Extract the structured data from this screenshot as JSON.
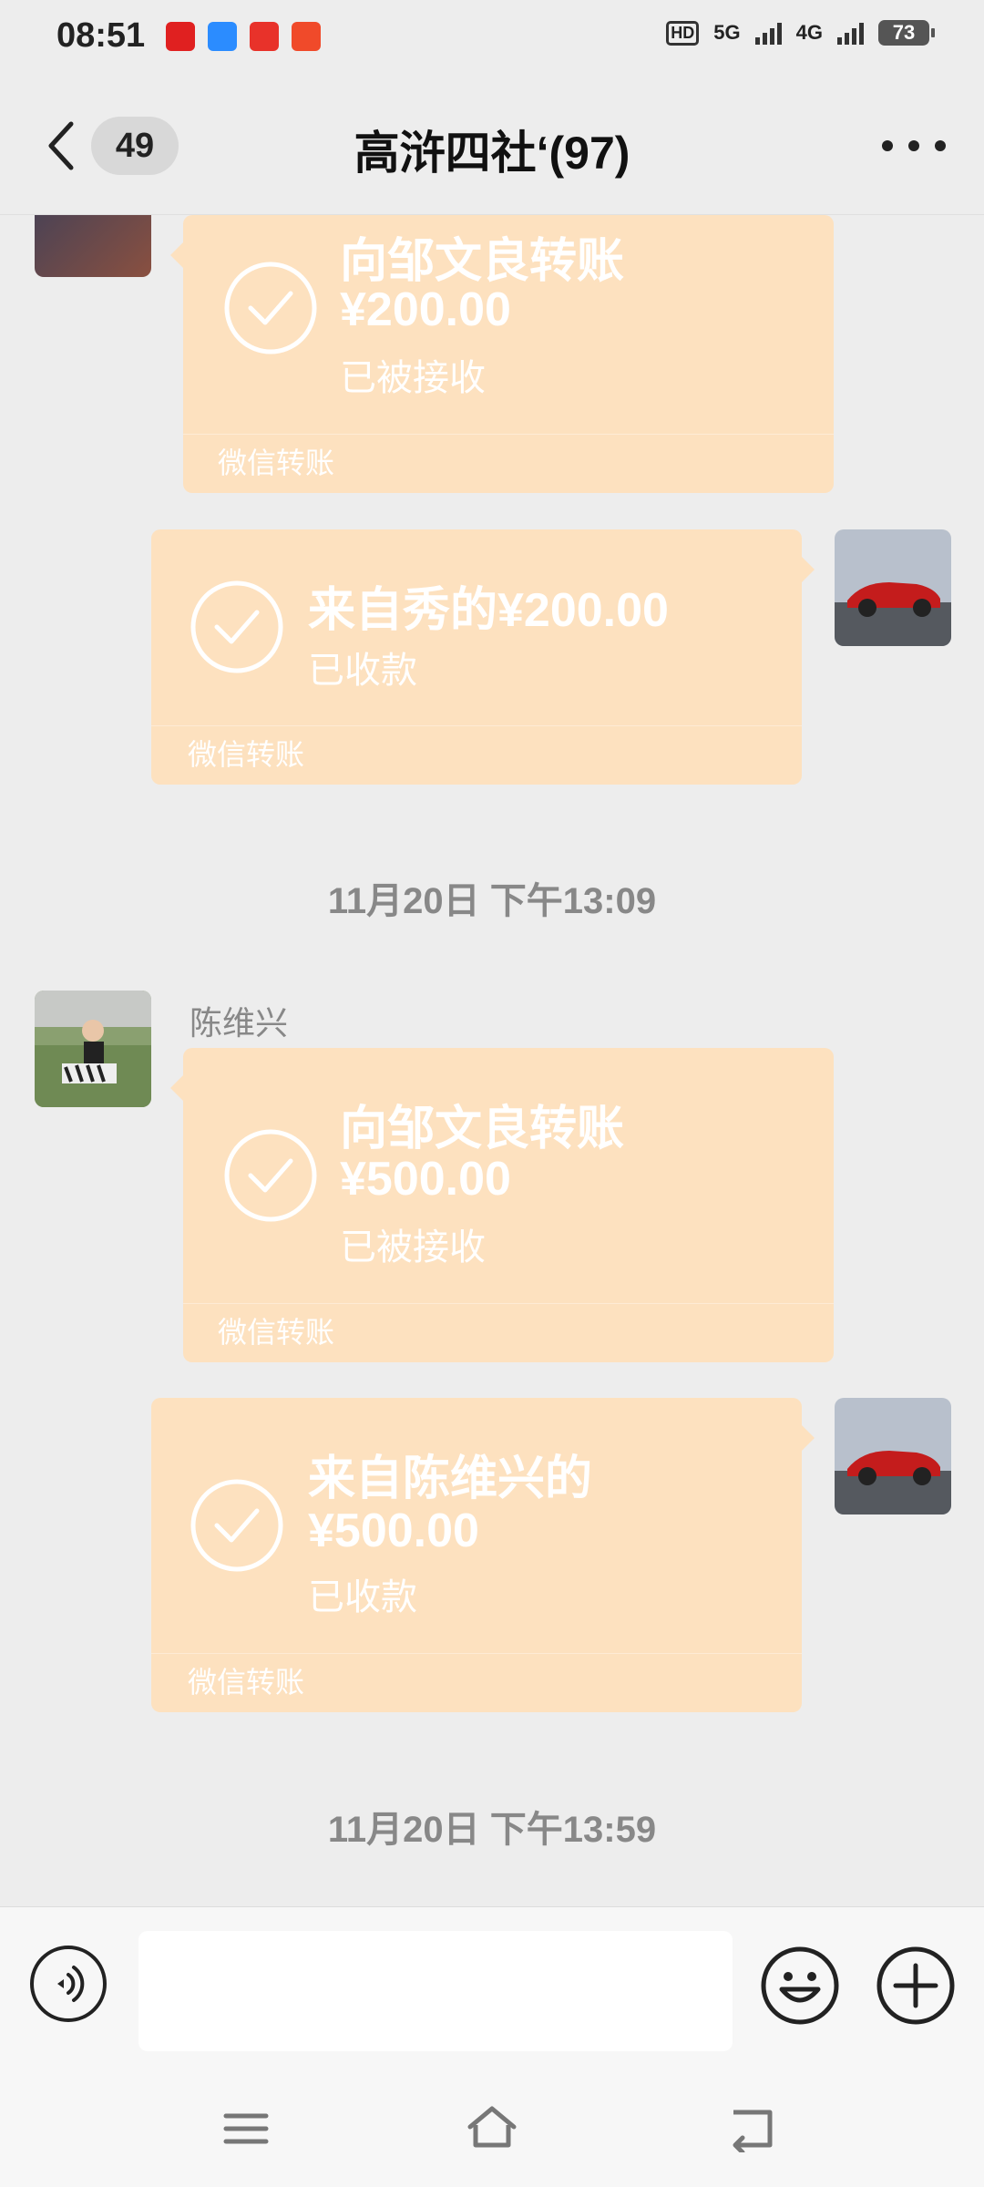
{
  "status_bar": {
    "time": "08:51",
    "network_hd": "HD",
    "network_5g": "5G",
    "network_4g": "4G",
    "battery": "73"
  },
  "header": {
    "unread_count": "49",
    "title": "高浒四社‘(97)"
  },
  "messages": [
    {
      "side": "left",
      "title": "向邹文良转账",
      "amount": "¥200.00",
      "status": "已被接收",
      "footer": "微信转账"
    },
    {
      "side": "right",
      "title": "来自秀的¥200.00",
      "status": "已收款",
      "footer": "微信转账"
    },
    {
      "timestamp": "11月20日 下午13:09"
    },
    {
      "side": "left",
      "sender": "陈维兴",
      "title": "向邹文良转账",
      "amount": "¥500.00",
      "status": "已被接收",
      "footer": "微信转账"
    },
    {
      "side": "right",
      "title": "来自陈维兴的",
      "amount": "¥500.00",
      "status": "已收款",
      "footer": "微信转账"
    },
    {
      "timestamp": "11月20日 下午13:59"
    }
  ],
  "input_bar": {
    "placeholder": ""
  },
  "colors": {
    "bubble": "#fde1bf",
    "background": "#ededed"
  },
  "icons": [
    "back-icon",
    "more-icon",
    "check-icon",
    "voice-icon",
    "emoji-icon",
    "plus-icon",
    "menu-icon",
    "home-icon",
    "back-nav-icon"
  ]
}
